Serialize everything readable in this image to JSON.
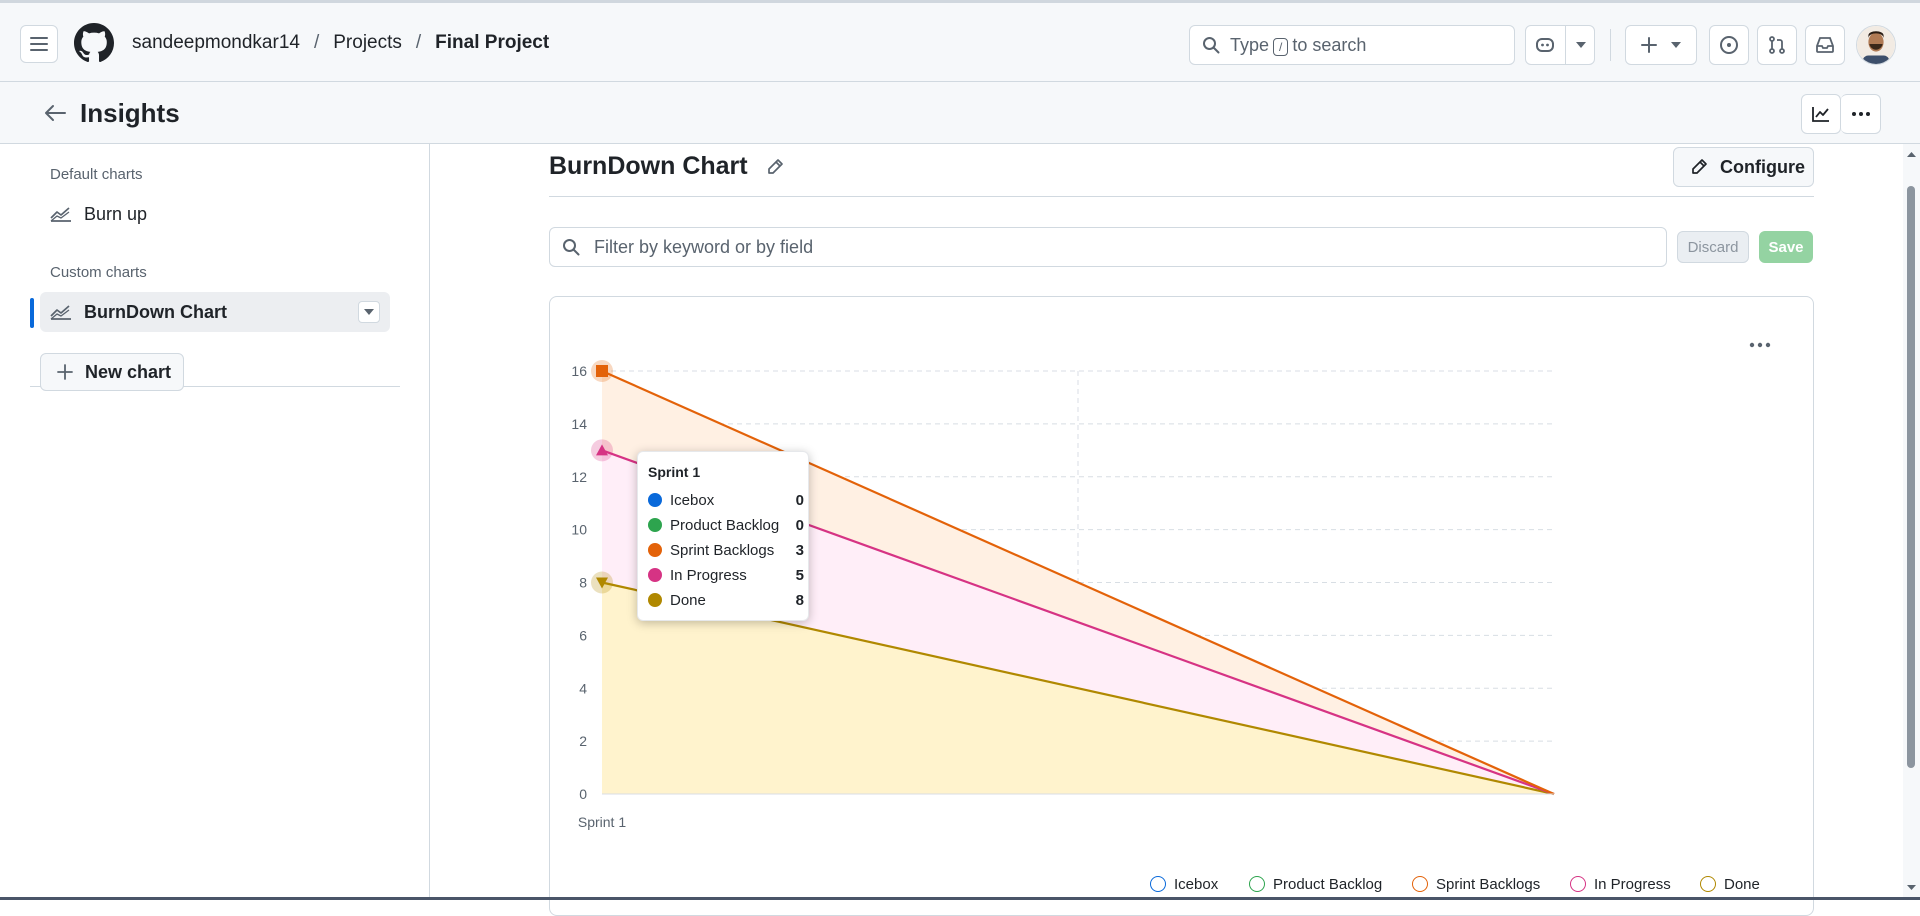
{
  "breadcrumb": {
    "owner": "sandeepmondkar14",
    "projects": "Projects",
    "project": "Final Project"
  },
  "search": {
    "pre": "Type",
    "key": "/",
    "post": "to search"
  },
  "page": {
    "title": "Insights"
  },
  "sidebar": {
    "default_head": "Default charts",
    "default_items": [
      {
        "label": "Burn up"
      }
    ],
    "custom_head": "Custom charts",
    "custom_items": [
      {
        "label": "BurnDown Chart"
      }
    ],
    "new_chart": "New chart"
  },
  "chart_panel": {
    "title": "BurnDown Chart",
    "configure": "Configure",
    "filter_placeholder": "Filter by keyword or by field",
    "discard": "Discard",
    "save": "Save"
  },
  "tooltip": {
    "title": "Sprint 1",
    "rows": [
      {
        "label": "Icebox",
        "value": "0",
        "color": "#0969da"
      },
      {
        "label": "Product Backlog",
        "value": "0",
        "color": "#2da44e"
      },
      {
        "label": "Sprint Backlogs",
        "value": "3",
        "color": "#e36209"
      },
      {
        "label": "In Progress",
        "value": "5",
        "color": "#d63384"
      },
      {
        "label": "Done",
        "value": "8",
        "color": "#b08800"
      }
    ]
  },
  "chart_data": {
    "type": "area",
    "stacked": true,
    "categories": [
      "Sprint 1",
      ""
    ],
    "xlabel": "",
    "ylabel": "",
    "ylim": [
      0,
      16
    ],
    "yticks": [
      0,
      2,
      4,
      6,
      8,
      10,
      12,
      14,
      16
    ],
    "grid": true,
    "legend_position": "bottom-right",
    "series": [
      {
        "name": "Icebox",
        "values": [
          0,
          0
        ],
        "color": "#0969da"
      },
      {
        "name": "Product Backlog",
        "values": [
          0,
          0
        ],
        "color": "#2da44e"
      },
      {
        "name": "Sprint Backlogs",
        "values": [
          3,
          0
        ],
        "color": "#e36209"
      },
      {
        "name": "In Progress",
        "values": [
          5,
          0
        ],
        "color": "#d63384"
      },
      {
        "name": "Done",
        "values": [
          8,
          0
        ],
        "color": "#b08800"
      }
    ]
  }
}
